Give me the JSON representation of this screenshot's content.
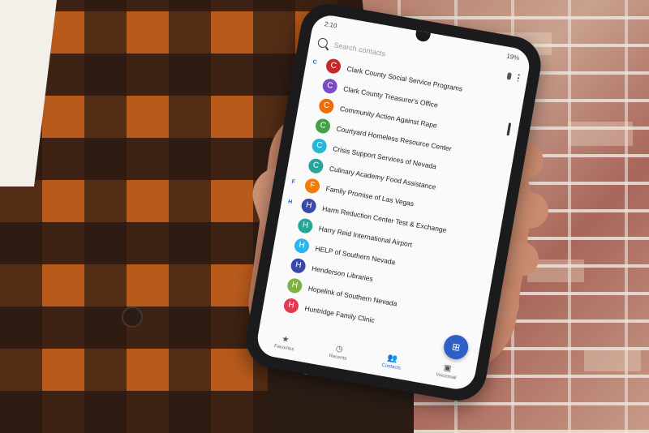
{
  "status": {
    "time": "2:10",
    "battery": "19%"
  },
  "search": {
    "placeholder": "Search contacts"
  },
  "contacts": [
    {
      "section": "C",
      "initial": "C",
      "name": "Clark County Social Service Programs",
      "color": "#c62828"
    },
    {
      "section": "",
      "initial": "C",
      "name": "Clark County Treasurer's Office",
      "color": "#7b4bc4"
    },
    {
      "section": "",
      "initial": "C",
      "name": "Community Action Against Rape",
      "color": "#ef6c00"
    },
    {
      "section": "",
      "initial": "C",
      "name": "Courtyard Homeless Resource Center",
      "color": "#43a047"
    },
    {
      "section": "",
      "initial": "C",
      "name": "Crisis Support Services of Nevada",
      "color": "#26b8d6"
    },
    {
      "section": "",
      "initial": "C",
      "name": "Culinary Academy Food Assistance",
      "color": "#26a69a"
    },
    {
      "section": "F",
      "initial": "F",
      "name": "Family Promise of Las Vegas",
      "color": "#f57c00"
    },
    {
      "section": "H",
      "initial": "H",
      "name": "Harm Reduction Center Test & Exchange",
      "color": "#3949ab"
    },
    {
      "section": "",
      "initial": "H",
      "name": "Harry Reid International Airport",
      "color": "#26a69a"
    },
    {
      "section": "",
      "initial": "H",
      "name": "HELP of Southern Nevada",
      "color": "#29b6f6"
    },
    {
      "section": "",
      "initial": "H",
      "name": "Henderson Libraries",
      "color": "#3949ab"
    },
    {
      "section": "",
      "initial": "H",
      "name": "Hopelink of Southern Nevada",
      "color": "#7cb342"
    },
    {
      "section": "",
      "initial": "H",
      "name": "Huntridge Family Clinic",
      "color": "#e53950"
    }
  ],
  "nav": [
    {
      "icon": "★",
      "label": "Favorites"
    },
    {
      "icon": "◷",
      "label": "Recents"
    },
    {
      "icon": "👥",
      "label": "Contacts"
    },
    {
      "icon": "▣",
      "label": "Voicemail"
    }
  ],
  "fab": {
    "icon": "⊞"
  }
}
